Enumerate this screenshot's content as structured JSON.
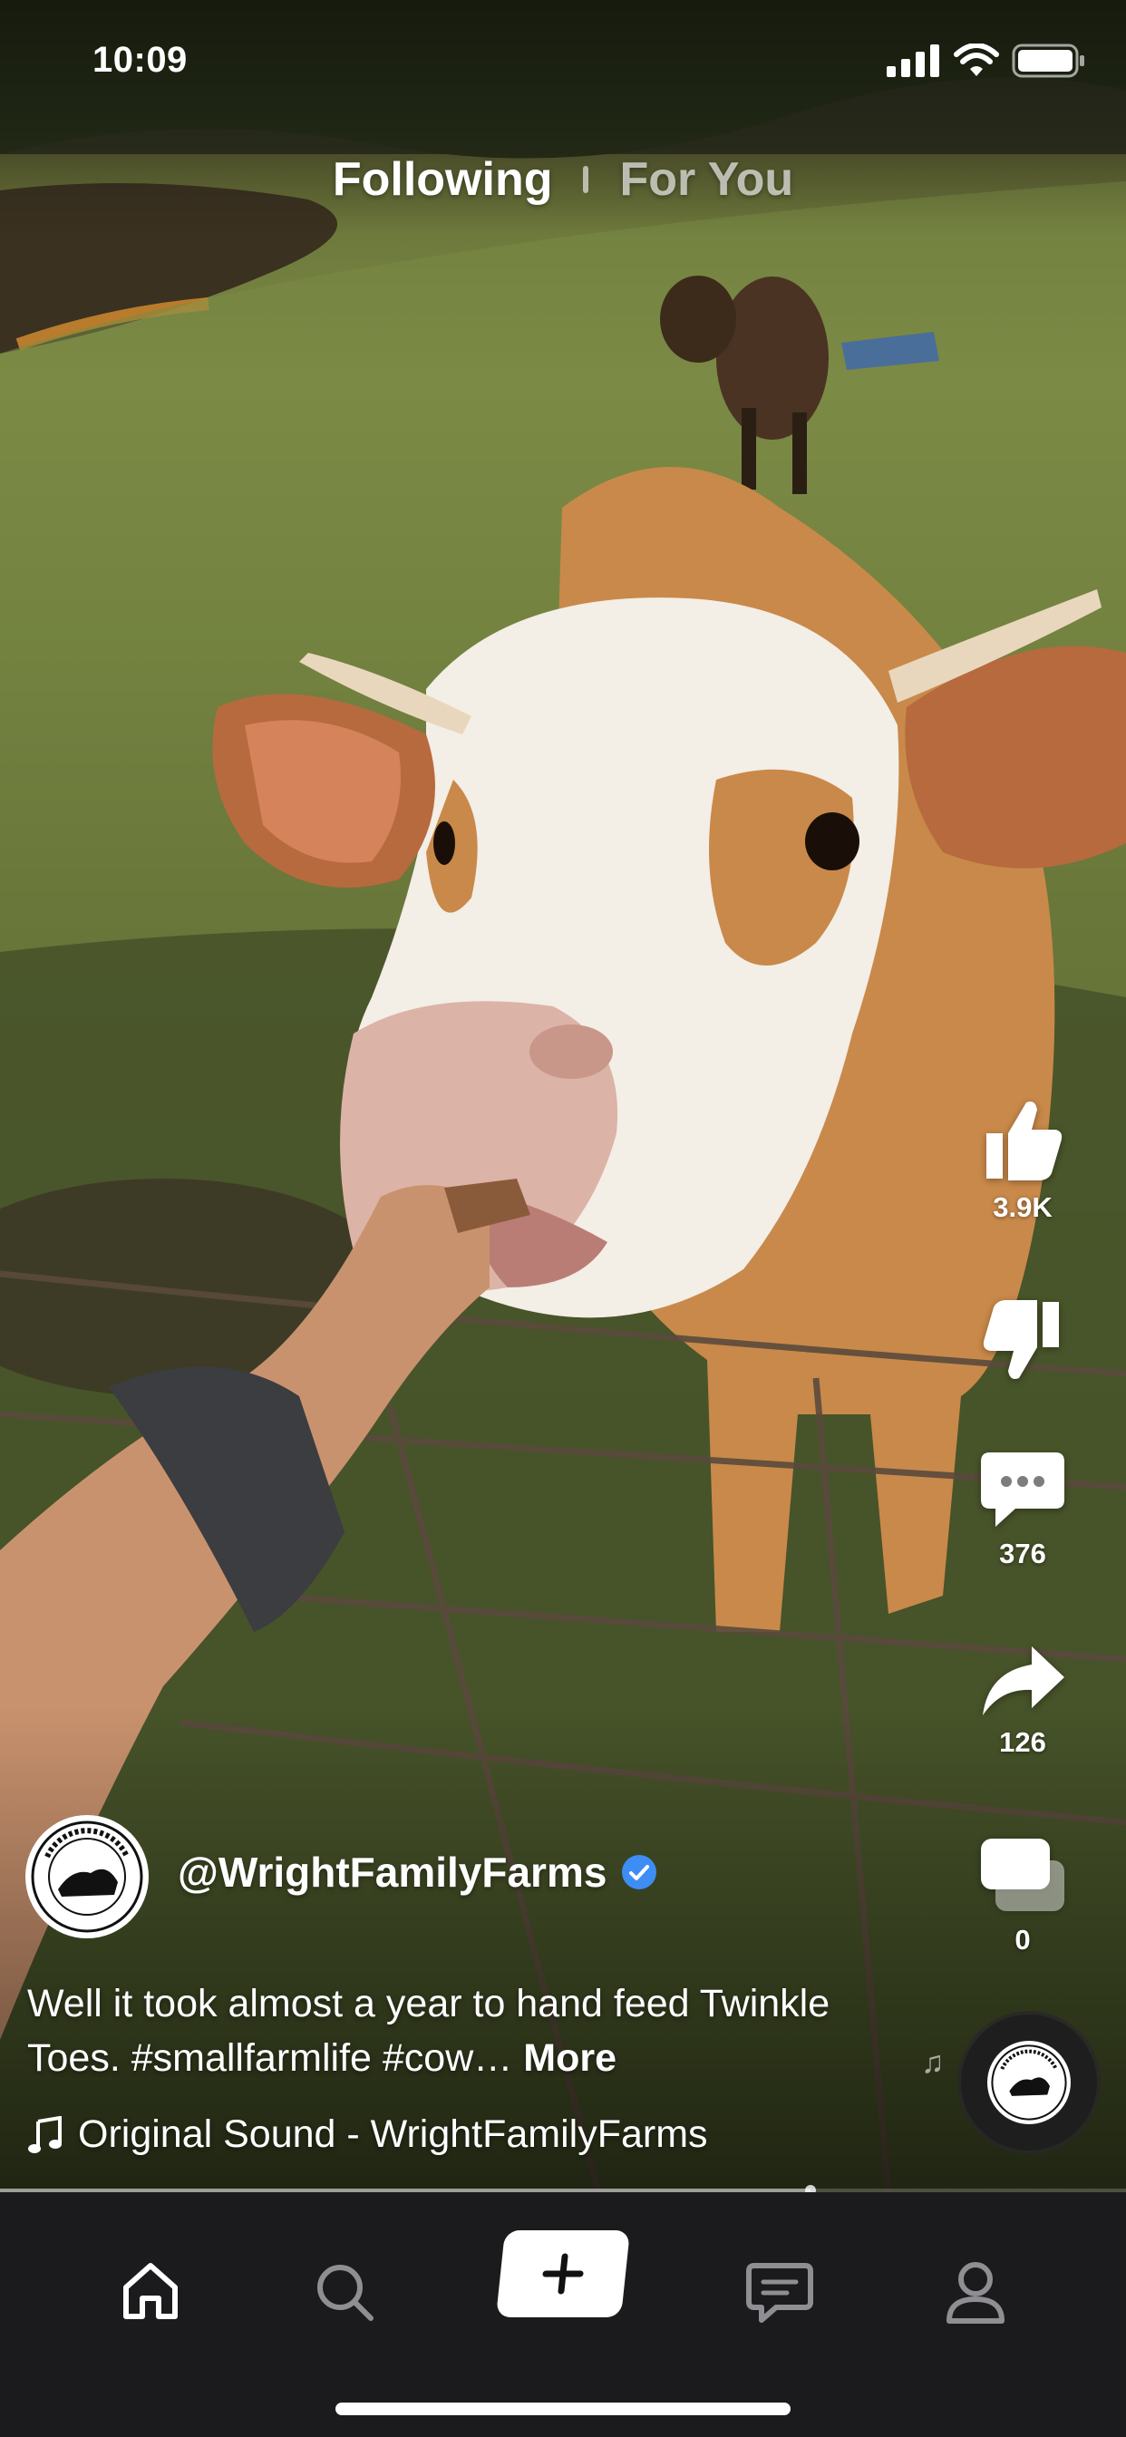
{
  "status_bar": {
    "time": "10:09"
  },
  "top_tabs": {
    "following": "Following",
    "for_you": "For You",
    "active": "Following"
  },
  "actions": {
    "like": {
      "icon": "thumbs-up-icon",
      "count": "3.9K"
    },
    "dislike": {
      "icon": "thumbs-down-icon"
    },
    "comment": {
      "icon": "comment-icon",
      "count": "376"
    },
    "share": {
      "icon": "share-icon",
      "count": "126"
    },
    "remix": {
      "icon": "remix-icon",
      "count": "0"
    }
  },
  "author": {
    "handle": "@WrightFamilyFarms",
    "verified": true,
    "avatar_text_top": "WRIGHT FAMILY FARMS",
    "avatar_text_bottom": "FAITH FAMILY FARMING"
  },
  "caption": {
    "text": "Well it took almost a year to hand feed Twinkle Toes. #smallfarmlife #cow…",
    "more": "More"
  },
  "sound": {
    "label": "Original Sound - WrightFamilyFarms"
  },
  "playback": {
    "progress": 0.72
  },
  "bottom_nav": {
    "items": [
      "home-icon",
      "search-icon",
      "create-icon",
      "inbox-icon",
      "profile-icon"
    ]
  },
  "colors": {
    "verified_badge": "#3d8df5",
    "nav_background": "#1b1b1d"
  }
}
